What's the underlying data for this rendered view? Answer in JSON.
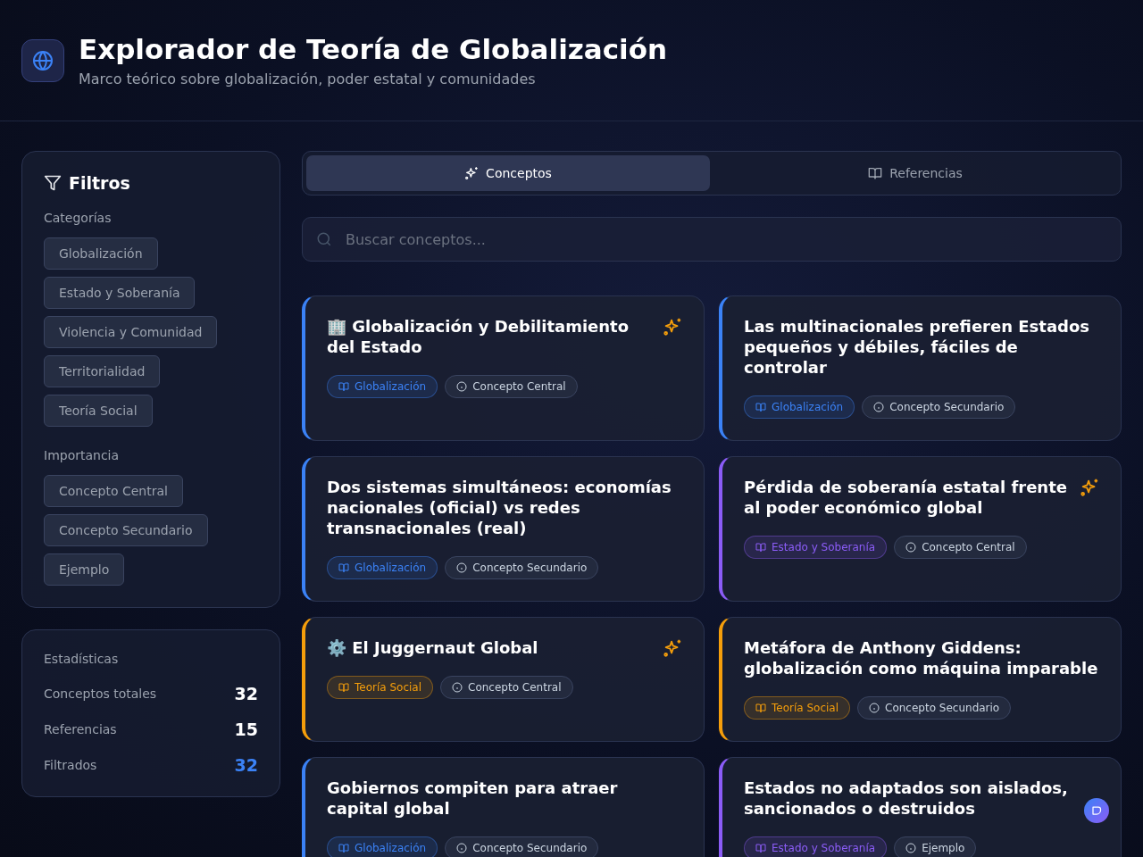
{
  "header": {
    "title": "Explorador de Teoría de Globalización",
    "subtitle": "Marco teórico sobre globalización, poder estatal y comunidades"
  },
  "filters": {
    "title": "Filtros",
    "groups": [
      {
        "label": "Categorías",
        "options": [
          "Globalización",
          "Estado y Soberanía",
          "Violencia y Comunidad",
          "Territorialidad",
          "Teoría Social"
        ]
      },
      {
        "label": "Importancia",
        "options": [
          "Concepto Central",
          "Concepto Secundario",
          "Ejemplo"
        ]
      }
    ]
  },
  "stats": {
    "title": "Estadísticas",
    "rows": [
      {
        "label": "Conceptos totales",
        "value": "32",
        "highlight": false
      },
      {
        "label": "Referencias",
        "value": "15",
        "highlight": false
      },
      {
        "label": "Filtrados",
        "value": "32",
        "highlight": true
      }
    ]
  },
  "tabs": [
    {
      "label": "Conceptos",
      "kind": "concepts",
      "selected": true
    },
    {
      "label": "Referencias",
      "kind": "references",
      "selected": false
    }
  ],
  "search": {
    "placeholder": "Buscar conceptos..."
  },
  "cards": [
    {
      "title": "🏢 Globalización y Debilitamiento del Estado",
      "category": "Globalización",
      "color": "#3b82f6",
      "importance": "Concepto Central",
      "featured": true
    },
    {
      "title": "Las multinacionales prefieren Estados pequeños y débiles, fáciles de controlar",
      "category": "Globalización",
      "color": "#3b82f6",
      "importance": "Concepto Secundario",
      "featured": false
    },
    {
      "title": "Dos sistemas simultáneos: economías nacionales (oficial) vs redes transnacionales (real)",
      "category": "Globalización",
      "color": "#3b82f6",
      "importance": "Concepto Secundario",
      "featured": false
    },
    {
      "title": "Pérdida de soberanía estatal frente al poder económico global",
      "category": "Estado y Soberanía",
      "color": "#8b5cf6",
      "importance": "Concepto Central",
      "featured": true
    },
    {
      "title": "⚙️ El Juggernaut Global",
      "category": "Teoría Social",
      "color": "#f59e0b",
      "importance": "Concepto Central",
      "featured": true
    },
    {
      "title": "Metáfora de Anthony Giddens: globalización como máquina imparable",
      "category": "Teoría Social",
      "color": "#f59e0b",
      "importance": "Concepto Secundario",
      "featured": false
    },
    {
      "title": "Gobiernos compiten para atraer capital global",
      "category": "Globalización",
      "color": "#3b82f6",
      "importance": "Concepto Secundario",
      "featured": false
    },
    {
      "title": "Estados no adaptados son aislados, sancionados o destruidos",
      "category": "Estado y Soberanía",
      "color": "#8b5cf6",
      "importance": "Ejemplo",
      "featured": false
    }
  ]
}
